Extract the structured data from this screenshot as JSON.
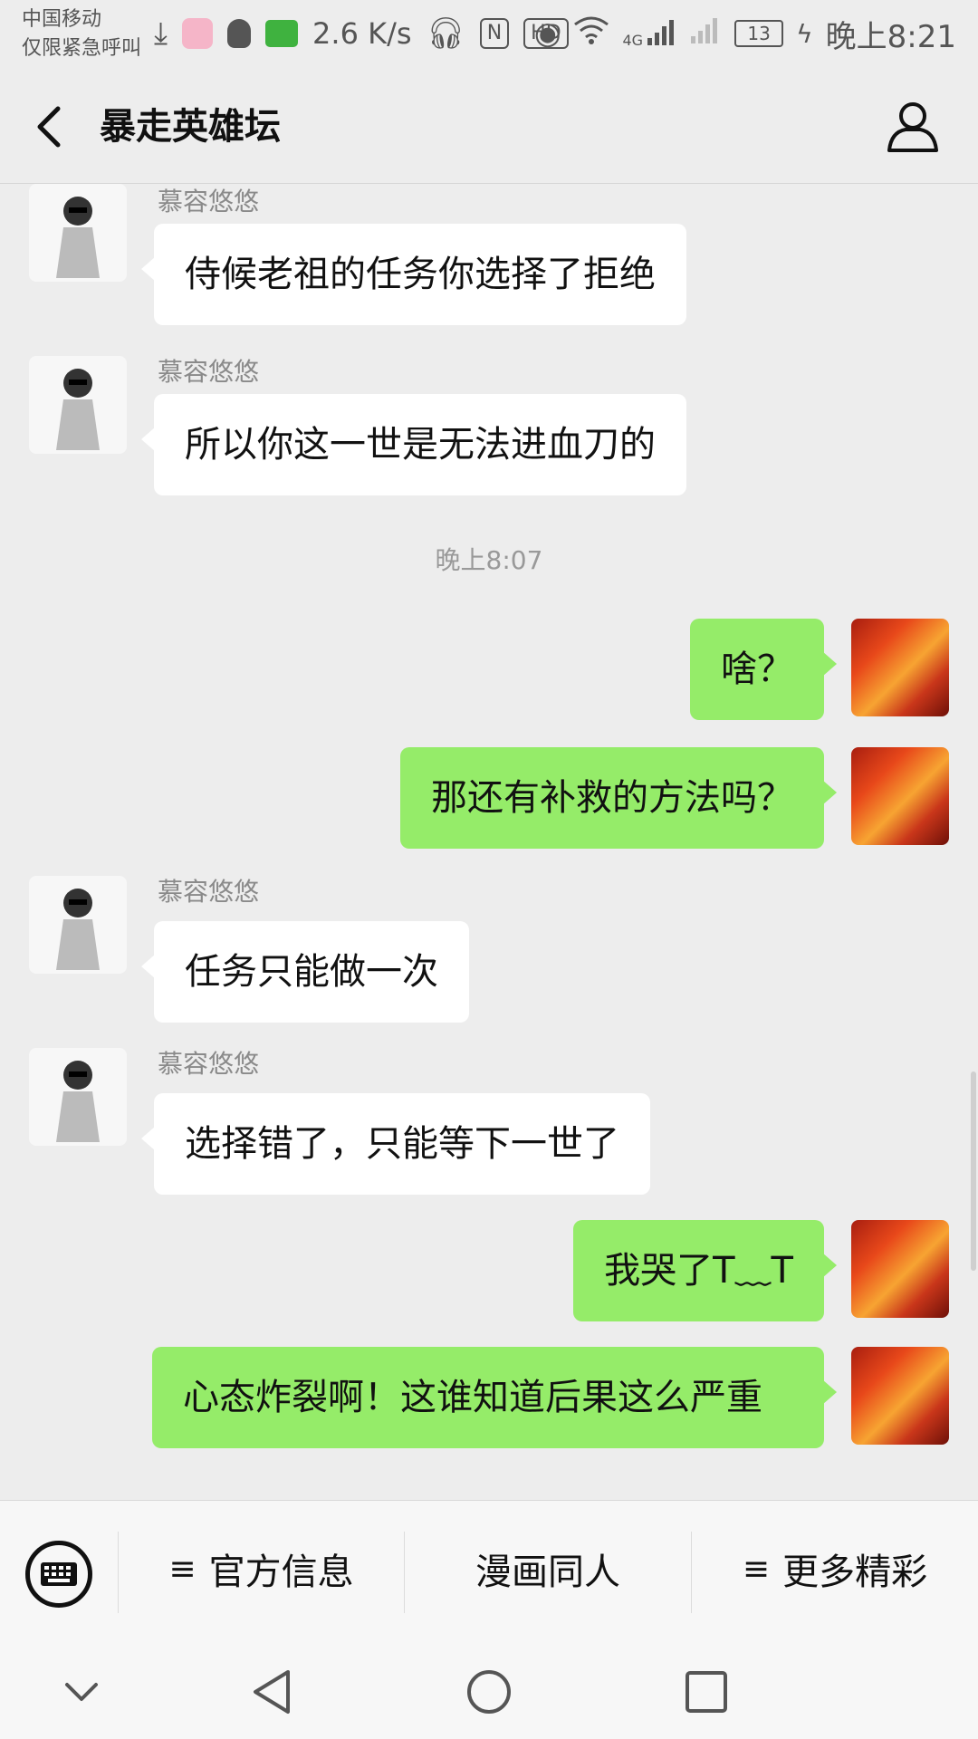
{
  "status_bar": {
    "carrier_line1": "中国移动",
    "carrier_line2": "仅限紧急呼叫",
    "net_speed": "2.6 K/s",
    "hd_label": "HD",
    "nfc_label": "N",
    "signal_label": "4G",
    "battery": "13",
    "time": "晚上8:21"
  },
  "header": {
    "title": "暴走英雄坛"
  },
  "messages": [
    {
      "side": "in",
      "sender": "慕容悠悠",
      "text": "侍候老祖的任务你选择了拒绝"
    },
    {
      "side": "in",
      "sender": "慕容悠悠",
      "text": "所以你这一世是无法进血刀的"
    },
    {
      "type": "time",
      "text": "晚上8:07"
    },
    {
      "side": "out",
      "text": "啥？"
    },
    {
      "side": "out",
      "text": "那还有补救的方法吗？"
    },
    {
      "side": "in",
      "sender": "慕容悠悠",
      "text": "任务只能做一次"
    },
    {
      "side": "in",
      "sender": "慕容悠悠",
      "text": "选择错了，只能等下一世了"
    },
    {
      "side": "out",
      "text": "我哭了T﹏T"
    },
    {
      "side": "out",
      "text": "心态炸裂啊！这谁知道后果这么严重"
    }
  ],
  "menu": {
    "items": [
      {
        "label": "官方信息",
        "hamburger": "≡"
      },
      {
        "label": "漫画同人",
        "hamburger": ""
      },
      {
        "label": "更多精彩",
        "hamburger": "≡"
      }
    ]
  },
  "colors": {
    "background": "#ededed",
    "bubble_out": "#95ec69",
    "bubble_in": "#ffffff"
  },
  "icons": {
    "back": "chevron-left-icon",
    "profile": "person-icon",
    "keyboard": "keyboard-icon",
    "nav_down": "chevron-down-icon",
    "nav_back": "triangle-back-icon",
    "nav_home": "circle-home-icon",
    "nav_recents": "square-recents-icon"
  }
}
